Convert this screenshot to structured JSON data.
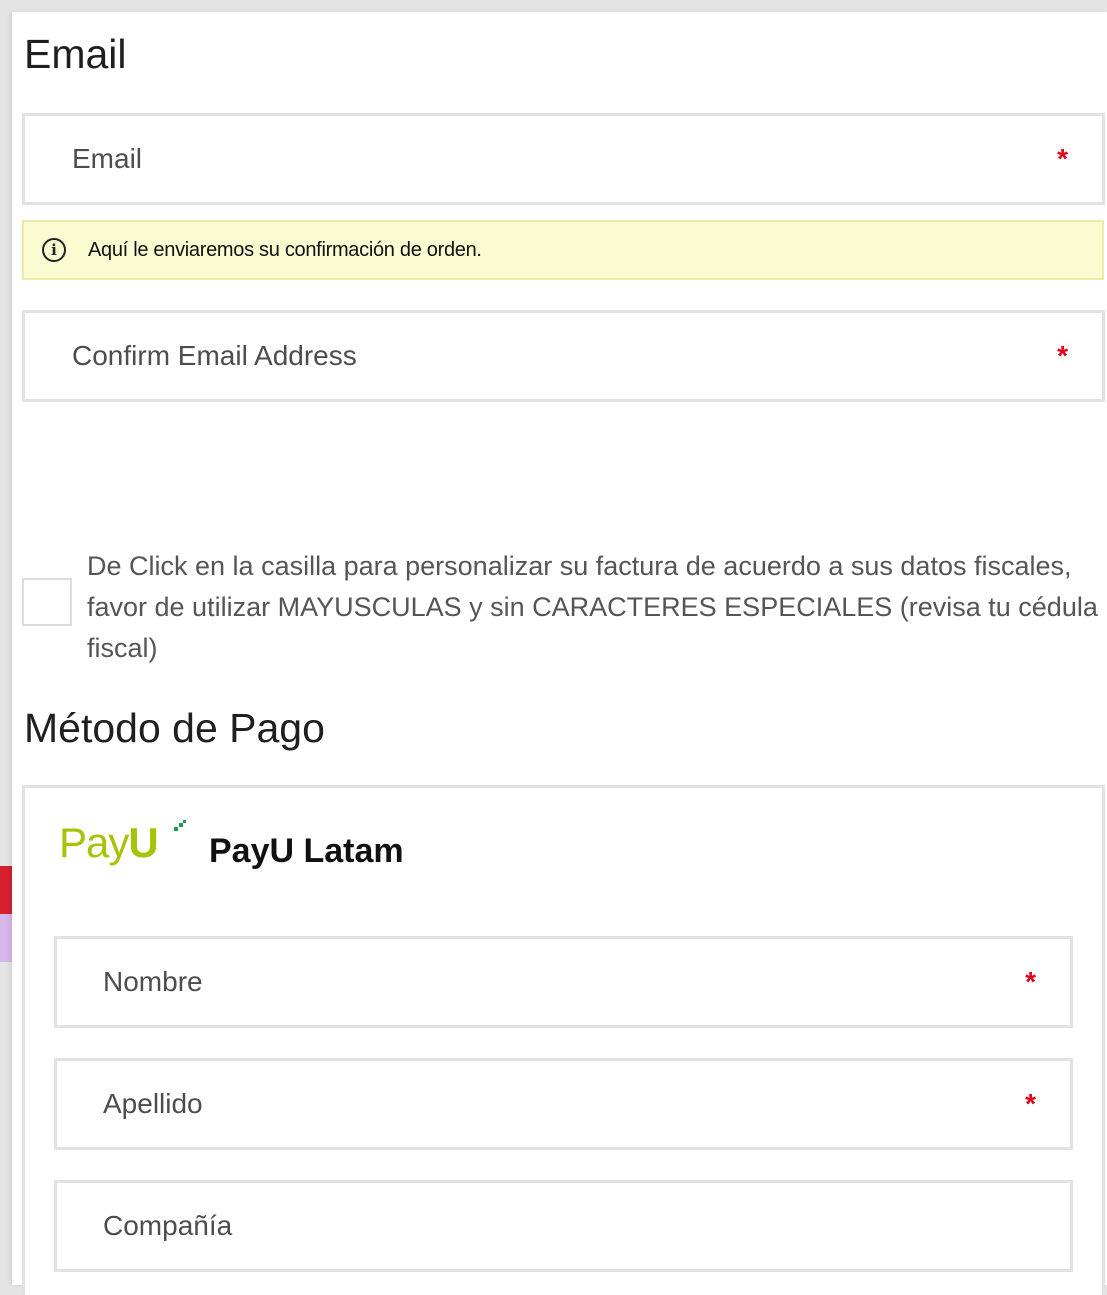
{
  "email_section": {
    "title": "Email",
    "email_label": "Email",
    "required_mark": "*",
    "notice": "Aquí le enviaremos su confirmación de orden.",
    "info_icon_glyph": "i",
    "confirm_label": "Confirm Email Address"
  },
  "invoice": {
    "checkbox_checked": false,
    "text": "De Click en la casilla para personalizar su factura de acuerdo a sus datos fiscales, favor de utilizar MAYUSCULAS y sin CARACTERES ESPECIALES (revisa tu cédula fiscal)"
  },
  "payment": {
    "title": "Método de Pago",
    "logo_text_1": "Pay",
    "logo_text_2": "U",
    "provider_name": "PayU Latam",
    "fields": [
      {
        "label": "Nombre",
        "required": "*"
      },
      {
        "label": "Apellido",
        "required": "*"
      },
      {
        "label": "Compañía"
      }
    ]
  },
  "colors": {
    "required": "#e0001b",
    "notice_bg": "#fbfbd2",
    "payu_green": "#a6c307",
    "payu_dots": "#1d9e4c"
  },
  "icons": {
    "info": "info-circle-icon",
    "payu": "payu-logo"
  }
}
